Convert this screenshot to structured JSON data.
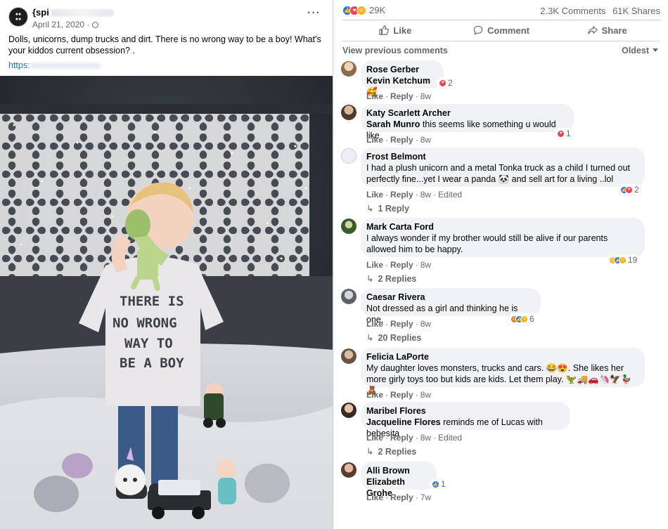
{
  "post": {
    "page_name": "{spi",
    "date": "April 21, 2020 ·",
    "more": "···",
    "text": "Dolls, unicorns, dump trucks and dirt. There is no wrong way to be a boy! What's your kiddos current obsession? .",
    "link": "https:",
    "shirt_text": [
      "THERE IS",
      "NO WRONG",
      "WAY TO",
      "BE A BOY"
    ]
  },
  "stats": {
    "reaction_count": "29K",
    "comments": "2.3K Comments",
    "shares": "61K Shares"
  },
  "actions": {
    "like": "Like",
    "comment": "Comment",
    "share": "Share"
  },
  "comments_header": {
    "view_previous": "View previous comments",
    "sort": "Oldest"
  },
  "comments": [
    {
      "name": "Rose Gerber",
      "tag": "Kevin Ketchum",
      "text": " 🥰",
      "react_count": "2",
      "like": "Like",
      "reply": "Reply",
      "time": "8w",
      "edited": "",
      "replies": ""
    },
    {
      "name": "Katy Scarlett Archer",
      "tag": "Sarah Munro",
      "text": " this seems like something u would like",
      "react_count": "1",
      "like": "Like",
      "reply": "Reply",
      "time": "8w",
      "edited": "",
      "replies": ""
    },
    {
      "name": "Frost Belmont",
      "tag": "",
      "text": "I had a plush unicorn and a metal Tonka truck as a child I turned out perfectly fine...yet I wear a panda 🐼 and sell art for a living ..lol",
      "react_count": "2",
      "like": "Like",
      "reply": "Reply",
      "time": "8w",
      "edited": "Edited",
      "replies": "1 Reply"
    },
    {
      "name": "Mark Carta Ford",
      "tag": "",
      "text": "I always wonder if my brother would still be alive if our parents allowed him to be happy.",
      "react_count": "19",
      "like": "Like",
      "reply": "Reply",
      "time": "8w",
      "edited": "",
      "replies": "2 Replies"
    },
    {
      "name": "Caesar Rivera",
      "tag": "",
      "text": "Not dressed as a girl and thinking he is one.",
      "react_count": "6",
      "like": "Like",
      "reply": "Reply",
      "time": "8w",
      "edited": "",
      "replies": "20 Replies"
    },
    {
      "name": "Felicia LaPorte",
      "tag": "",
      "text": "My daughter loves monsters, trucks and cars. 😂😍. She likes her more girly toys too but kids are kids. Let them play. 🦖🚚🚗🦄🦅🦆🧸",
      "react_count": "",
      "like": "Like",
      "reply": "Reply",
      "time": "8w",
      "edited": "",
      "replies": ""
    },
    {
      "name": "Maribel Flores",
      "tag": "Jacqueline Flores",
      "text": " reminds me of Lucas with bebesita",
      "react_count": "",
      "like": "Like",
      "reply": "Reply",
      "time": "8w",
      "edited": "Edited",
      "replies": "2 Replies"
    },
    {
      "name": "Alli Brown",
      "tag": "Elizabeth Grohe",
      "text": "",
      "react_count": "1",
      "like": "Like",
      "reply": "Reply",
      "time": "7w",
      "edited": "",
      "replies": ""
    }
  ]
}
